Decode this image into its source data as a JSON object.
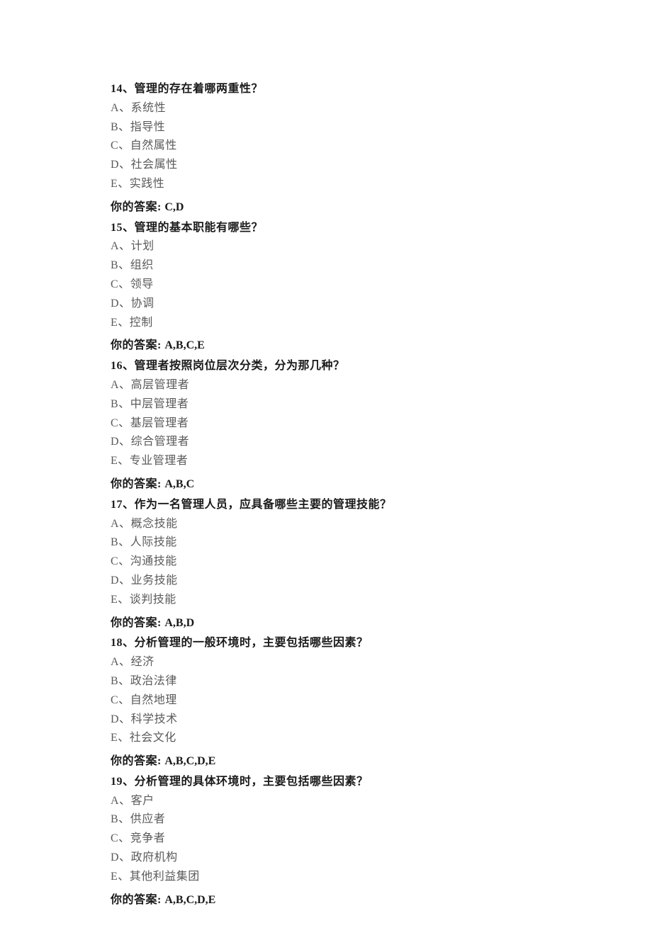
{
  "answer_label": "你的答案: ",
  "questions": [
    {
      "number": "14、",
      "text": "管理的存在着哪两重性？",
      "options": [
        {
          "letter": "A、",
          "text": "系统性"
        },
        {
          "letter": "B、",
          "text": "指导性"
        },
        {
          "letter": "C、",
          "text": "自然属性"
        },
        {
          "letter": "D、",
          "text": "社会属性"
        },
        {
          "letter": "E、",
          "text": "实践性"
        }
      ],
      "answer": "C,D"
    },
    {
      "number": "15、",
      "text": "管理的基本职能有哪些？",
      "options": [
        {
          "letter": "A、",
          "text": "计划"
        },
        {
          "letter": "B、",
          "text": "组织"
        },
        {
          "letter": "C、",
          "text": "领导"
        },
        {
          "letter": "D、",
          "text": "协调"
        },
        {
          "letter": "E、",
          "text": "控制"
        }
      ],
      "answer": "A,B,C,E"
    },
    {
      "number": "16、",
      "text": "管理者按照岗位层次分类，分为那几种？",
      "options": [
        {
          "letter": "A、",
          "text": "高层管理者"
        },
        {
          "letter": "B、",
          "text": "中层管理者"
        },
        {
          "letter": "C、",
          "text": "基层管理者"
        },
        {
          "letter": "D、",
          "text": "综合管理者"
        },
        {
          "letter": "E、",
          "text": "专业管理者"
        }
      ],
      "answer": "A,B,C"
    },
    {
      "number": "17、",
      "text": "作为一名管理人员，应具备哪些主要的管理技能？",
      "options": [
        {
          "letter": "A、",
          "text": "概念技能"
        },
        {
          "letter": "B、",
          "text": "人际技能"
        },
        {
          "letter": "C、",
          "text": "沟通技能"
        },
        {
          "letter": "D、",
          "text": "业务技能"
        },
        {
          "letter": "E、",
          "text": "谈判技能"
        }
      ],
      "answer": "A,B,D"
    },
    {
      "number": "18、",
      "text": "分析管理的一般环境时，主要包括哪些因素？",
      "options": [
        {
          "letter": "A、",
          "text": "经济"
        },
        {
          "letter": "B、",
          "text": "政治法律"
        },
        {
          "letter": "C、",
          "text": "自然地理"
        },
        {
          "letter": "D、",
          "text": "科学技术"
        },
        {
          "letter": "E、",
          "text": "社会文化"
        }
      ],
      "answer": "A,B,C,D,E"
    },
    {
      "number": "19、",
      "text": "分析管理的具体环境时，主要包括哪些因素？",
      "options": [
        {
          "letter": "A、",
          "text": "客户"
        },
        {
          "letter": "B、",
          "text": "供应者"
        },
        {
          "letter": "C、",
          "text": "竞争者"
        },
        {
          "letter": "D、",
          "text": "政府机构"
        },
        {
          "letter": "E、",
          "text": "其他利益集团"
        }
      ],
      "answer": "A,B,C,D,E"
    }
  ]
}
